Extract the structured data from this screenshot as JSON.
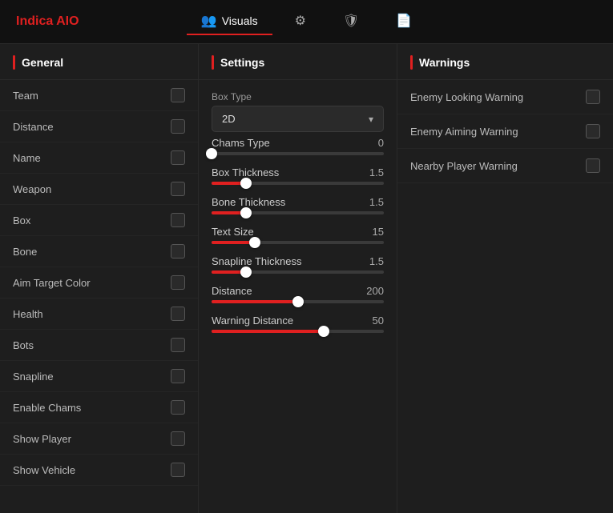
{
  "brand": "Indica AIO",
  "nav": {
    "tabs": [
      {
        "id": "visuals",
        "label": "Visuals",
        "icon": "👥",
        "active": true
      },
      {
        "id": "settings",
        "label": "",
        "icon": "⚙",
        "active": false
      },
      {
        "id": "shield",
        "label": "",
        "icon": "🛡",
        "active": false
      },
      {
        "id": "file",
        "label": "",
        "icon": "📄",
        "active": false
      }
    ]
  },
  "panels": {
    "general": {
      "header": "General",
      "items": [
        {
          "label": "Team"
        },
        {
          "label": "Distance"
        },
        {
          "label": "Name"
        },
        {
          "label": "Weapon"
        },
        {
          "label": "Box"
        },
        {
          "label": "Bone"
        },
        {
          "label": "Aim Target Color"
        },
        {
          "label": "Health"
        },
        {
          "label": "Bots"
        },
        {
          "label": "Snapline"
        },
        {
          "label": "Enable Chams"
        },
        {
          "label": "Show Player"
        },
        {
          "label": "Show Vehicle"
        }
      ]
    },
    "settings": {
      "header": "Settings",
      "boxTypeLabel": "Box Type",
      "boxTypeValue": "2D",
      "sliders": [
        {
          "id": "chams-type",
          "label": "Chams Type",
          "value": 0,
          "fill": 0,
          "thumb": 0
        },
        {
          "id": "box-thickness",
          "label": "Box Thickness",
          "value": 1.5,
          "fill": 20,
          "thumb": 20
        },
        {
          "id": "bone-thickness",
          "label": "Bone Thickness",
          "value": 1.5,
          "fill": 20,
          "thumb": 20
        },
        {
          "id": "text-size",
          "label": "Text Size",
          "value": 15.0,
          "fill": 25,
          "thumb": 25
        },
        {
          "id": "snapline-thickness",
          "label": "Snapline Thickness",
          "value": 1.5,
          "fill": 20,
          "thumb": 20
        },
        {
          "id": "distance",
          "label": "Distance",
          "value": 200.0,
          "fill": 50,
          "thumb": 50
        },
        {
          "id": "warning-distance",
          "label": "Warning Distance",
          "value": 50.0,
          "fill": 65,
          "thumb": 65
        }
      ]
    },
    "warnings": {
      "header": "Warnings",
      "items": [
        {
          "label": "Enemy Looking Warning"
        },
        {
          "label": "Enemy Aiming Warning"
        },
        {
          "label": "Nearby Player Warning"
        }
      ]
    }
  }
}
